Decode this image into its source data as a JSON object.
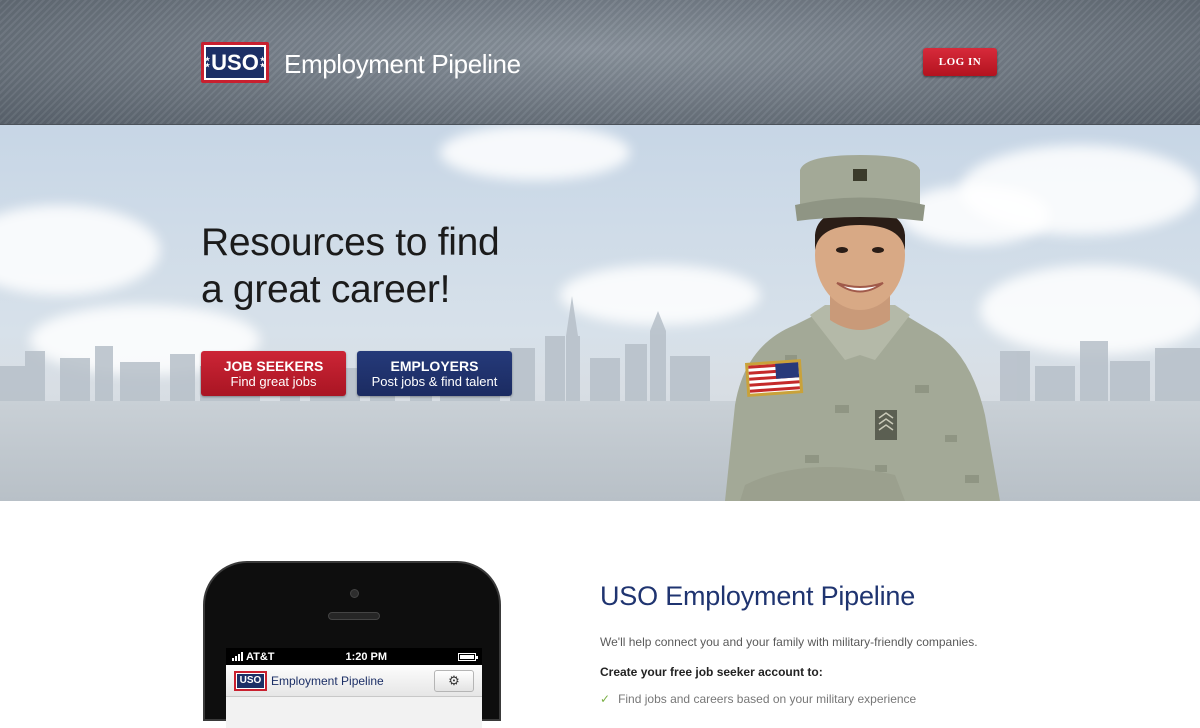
{
  "header": {
    "logo_text": "USO",
    "brand_title": "Employment Pipeline",
    "login_label": "LOG IN"
  },
  "hero": {
    "headline_line1": "Resources to find",
    "headline_line2": "a great career!",
    "job_seekers": {
      "title": "JOB SEEKERS",
      "subtitle": "Find great jobs"
    },
    "employers": {
      "title": "EMPLOYERS",
      "subtitle": "Post jobs & find talent"
    }
  },
  "phone": {
    "carrier": "AT&T",
    "time": "1:20 PM",
    "logo_text": "USO",
    "app_title": "Employment Pipeline",
    "settings_icon": "gear-icon"
  },
  "about": {
    "title": "USO Employment Pipeline",
    "lead": "We'll help connect you and your family with military-friendly companies.",
    "subheading": "Create your free job seeker account to:",
    "items": [
      "Find jobs and careers based on your military experience"
    ]
  },
  "colors": {
    "brand_red": "#c8202f",
    "brand_navy": "#1c2f66",
    "title_blue": "#1f3470"
  }
}
